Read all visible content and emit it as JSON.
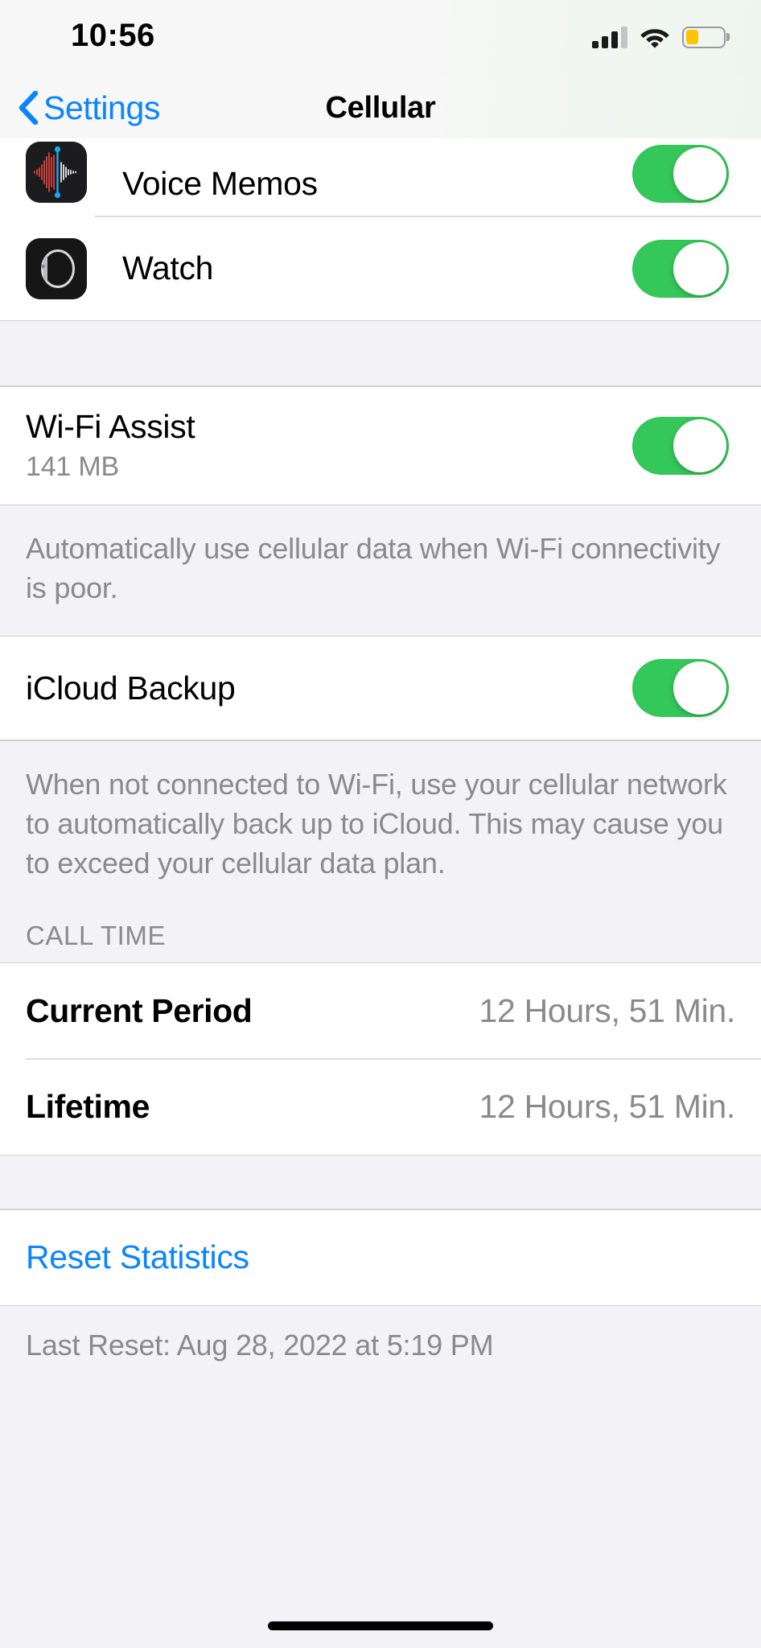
{
  "status_bar": {
    "time": "10:56",
    "cellular_icon": "cellular-signal-icon",
    "cellular_bars_filled": 3,
    "cellular_bars_total": 4,
    "wifi_icon": "wifi-icon",
    "battery_icon": "battery-icon",
    "battery_level_percent": 34,
    "battery_color": "#FFC300"
  },
  "nav": {
    "back_label": "Settings",
    "back_icon": "chevron-left-icon",
    "title": "Cellular",
    "tint_color": "#0A84FF"
  },
  "apps": [
    {
      "name": "Voice Memos",
      "icon": "voice-memos-icon",
      "toggle_on": true
    },
    {
      "name": "Watch",
      "icon": "apple-watch-icon",
      "toggle_on": true
    }
  ],
  "wifi_assist": {
    "title": "Wi-Fi Assist",
    "subtitle": "141 MB",
    "toggle_on": true,
    "footer": "Automatically use cellular data when Wi-Fi connectivity is poor."
  },
  "icloud_backup": {
    "title": "iCloud Backup",
    "toggle_on": true,
    "footer": "When not connected to Wi-Fi, use your cellular network to automatically back up to iCloud. This may cause you to exceed your cellular data plan."
  },
  "call_time": {
    "header": "CALL TIME",
    "rows": [
      {
        "label": "Current Period",
        "value": "12 Hours, 51 Min."
      },
      {
        "label": "Lifetime",
        "value": "12 Hours, 51 Min."
      }
    ]
  },
  "reset": {
    "label": "Reset Statistics",
    "last_reset": "Last Reset: Aug 28, 2022 at 5:19 PM"
  },
  "colors": {
    "toggle_on": "#34C759",
    "link": "#0A84FF",
    "group_bg": "#F2F2F7",
    "secondary_text": "#8A8A8E"
  }
}
